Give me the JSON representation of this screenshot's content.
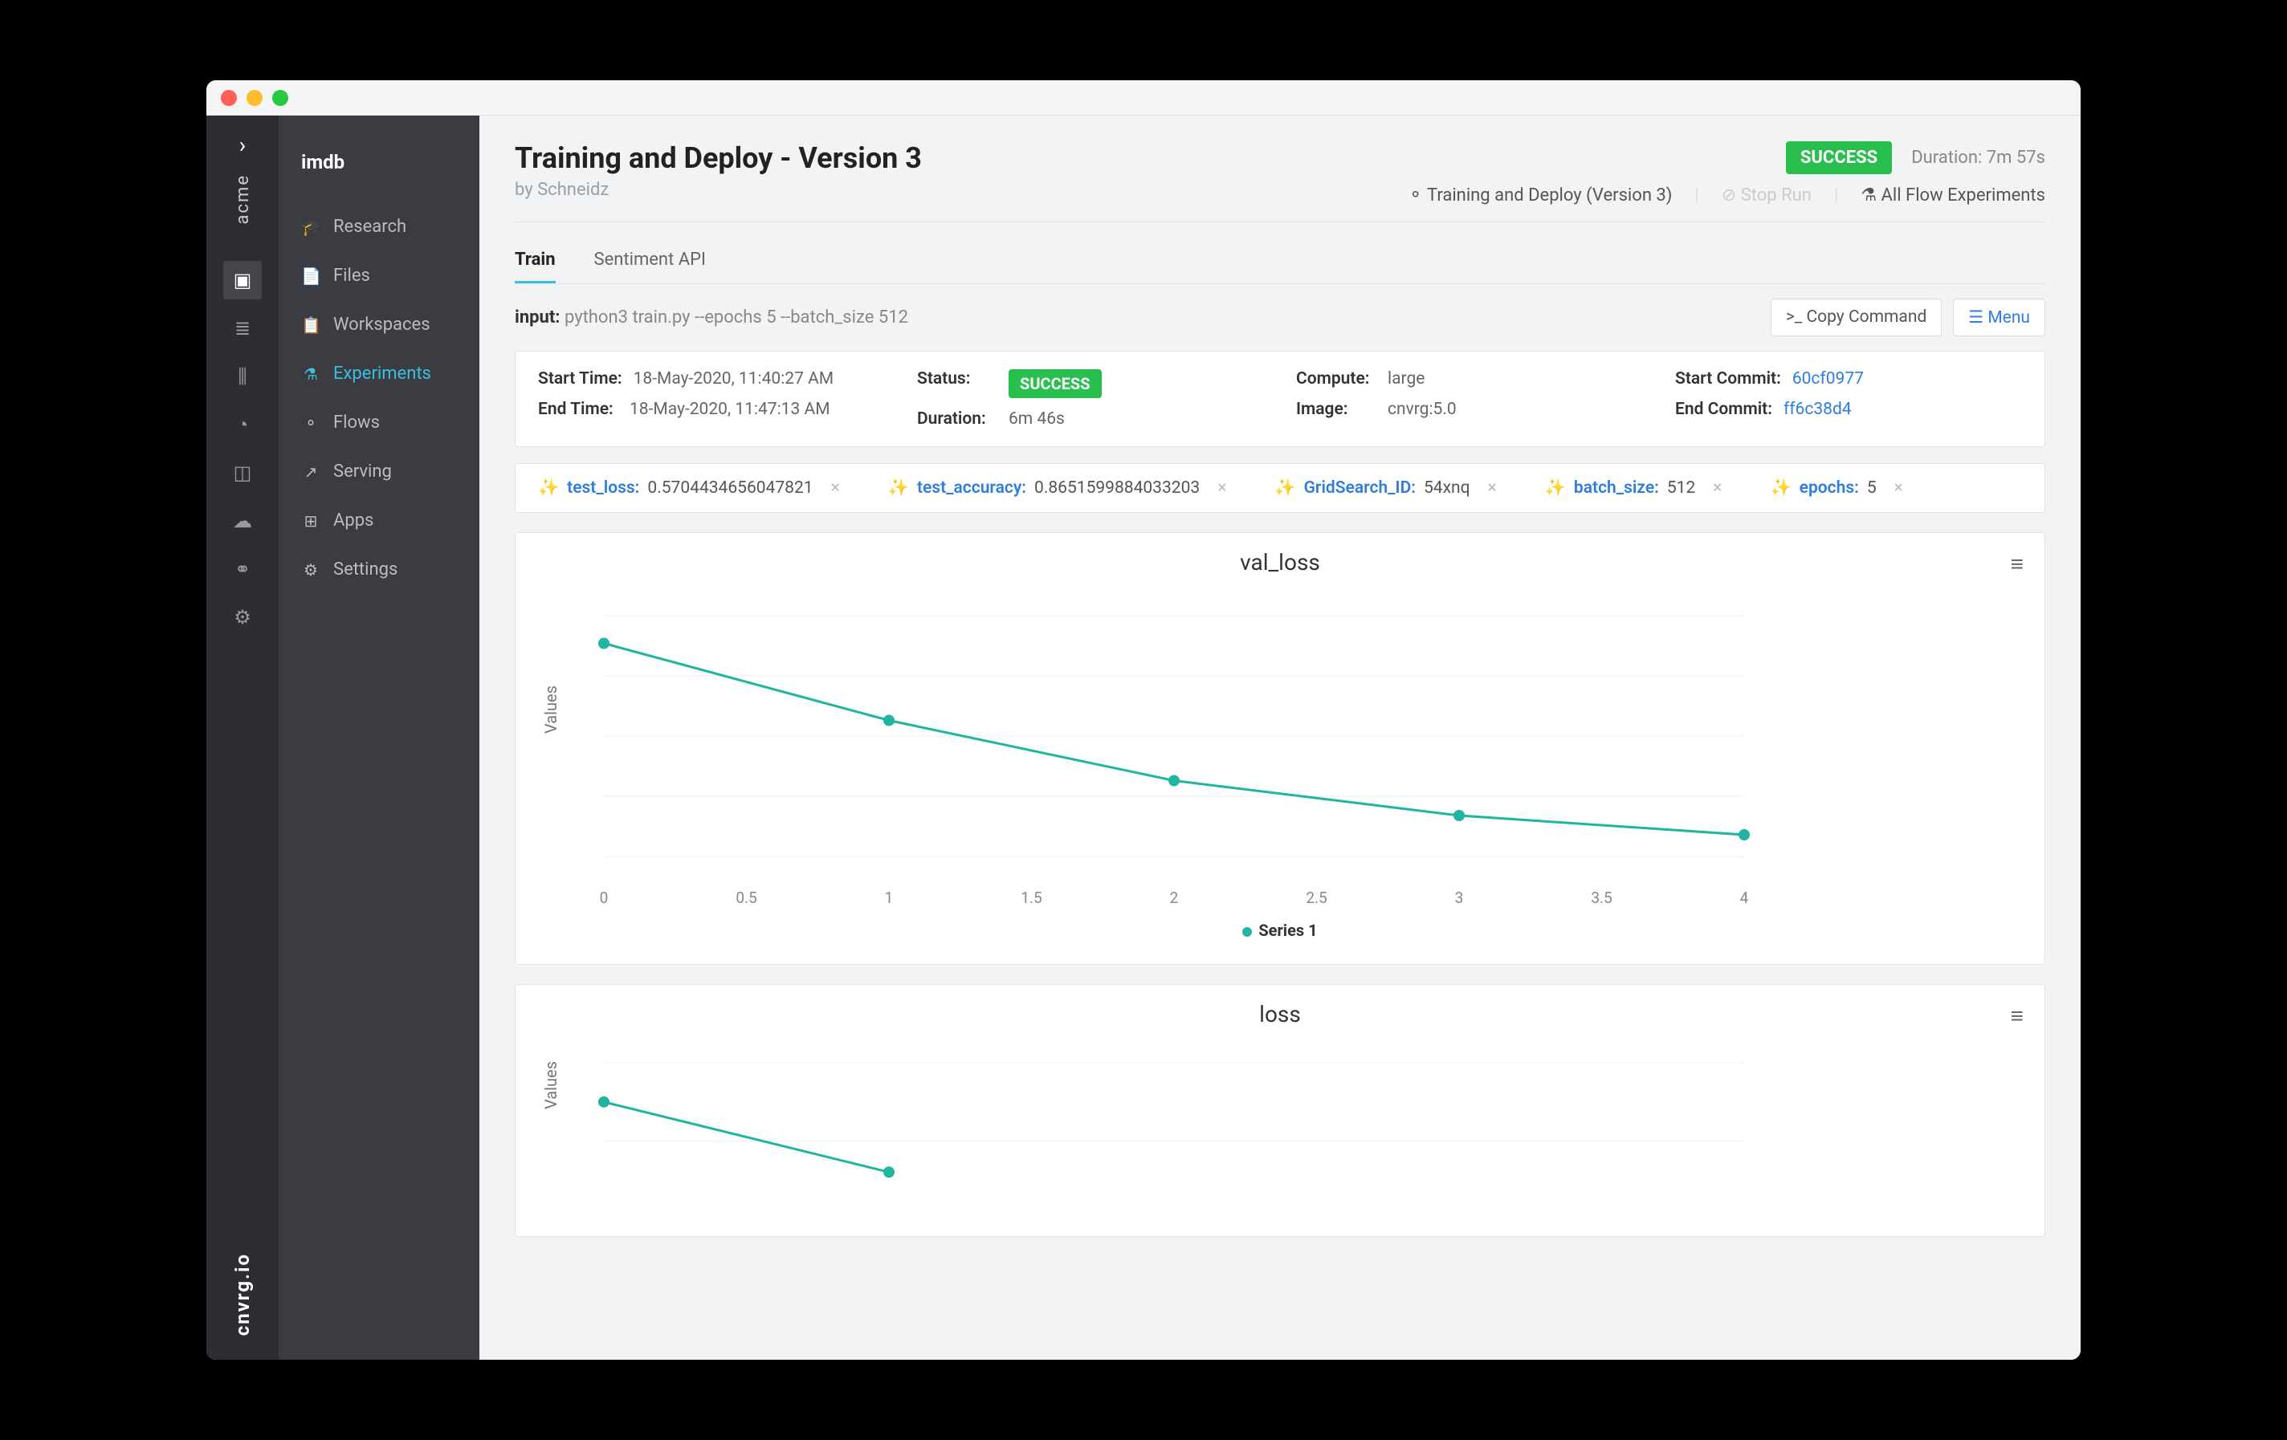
{
  "org": "acme",
  "brand": "cnvrg.io",
  "project": "imdb",
  "sidebar": {
    "items": [
      {
        "label": "Research",
        "icon": "🎓"
      },
      {
        "label": "Files",
        "icon": "📄"
      },
      {
        "label": "Workspaces",
        "icon": "📋"
      },
      {
        "label": "Experiments",
        "icon": "⚗"
      },
      {
        "label": "Flows",
        "icon": "⚬"
      },
      {
        "label": "Serving",
        "icon": "↗"
      },
      {
        "label": "Apps",
        "icon": "⊞"
      },
      {
        "label": "Settings",
        "icon": "⚙"
      }
    ],
    "active_index": 3
  },
  "header": {
    "title": "Training and Deploy - Version 3",
    "by_prefix": "by ",
    "author": "Schneidz",
    "status": "SUCCESS",
    "duration_label": "Duration:",
    "duration": "7m 57s",
    "flow_link": "Training and Deploy (Version 3)",
    "stop_run": "Stop Run",
    "all_flows": "All Flow Experiments"
  },
  "tabs": [
    {
      "label": "Train",
      "active": true
    },
    {
      "label": "Sentiment API",
      "active": false
    }
  ],
  "command": {
    "label": "input:",
    "value": "python3 train.py --epochs 5 --batch_size 512",
    "copy": ">_ Copy Command",
    "menu": "Menu"
  },
  "info": {
    "start_time_label": "Start Time:",
    "start_time": "18-May-2020, 11:40:27 AM",
    "end_time_label": "End Time:",
    "end_time": "18-May-2020, 11:47:13 AM",
    "status_label": "Status:",
    "status": "SUCCESS",
    "duration_label": "Duration:",
    "duration": "6m 46s",
    "compute_label": "Compute:",
    "compute": "large",
    "image_label": "Image:",
    "image": "cnvrg:5.0",
    "start_commit_label": "Start Commit:",
    "start_commit": "60cf0977",
    "end_commit_label": "End Commit:",
    "end_commit": "ff6c38d4"
  },
  "tags": [
    {
      "key": "test_loss:",
      "val": "0.5704434656047821"
    },
    {
      "key": "test_accuracy:",
      "val": "0.8651599884033203"
    },
    {
      "key": "GridSearch_ID:",
      "val": "54xnq"
    },
    {
      "key": "batch_size:",
      "val": "512"
    },
    {
      "key": "epochs:",
      "val": "5"
    }
  ],
  "chart_data": [
    {
      "type": "line",
      "title": "val_loss",
      "ylabel": "Values",
      "x": [
        0,
        1,
        2,
        3,
        4
      ],
      "xticks": [
        0,
        0.5,
        1,
        1.5,
        2,
        2.5,
        3,
        3.5,
        4
      ],
      "yticks": [
        0.55,
        0.6,
        0.65,
        0.7,
        0.75
      ],
      "ylim": [
        0.53,
        0.77
      ],
      "series": [
        {
          "name": "Series 1",
          "values": [
            0.727,
            0.663,
            0.613,
            0.584,
            0.568
          ]
        }
      ]
    },
    {
      "type": "line",
      "title": "loss",
      "ylabel": "Values",
      "x": [
        0,
        1
      ],
      "yticks": [
        1,
        1.2
      ],
      "ylim": [
        0.9,
        1.25
      ],
      "series": [
        {
          "name": "Series 1",
          "values": [
            1.1,
            0.92
          ]
        }
      ],
      "partial": true
    }
  ]
}
